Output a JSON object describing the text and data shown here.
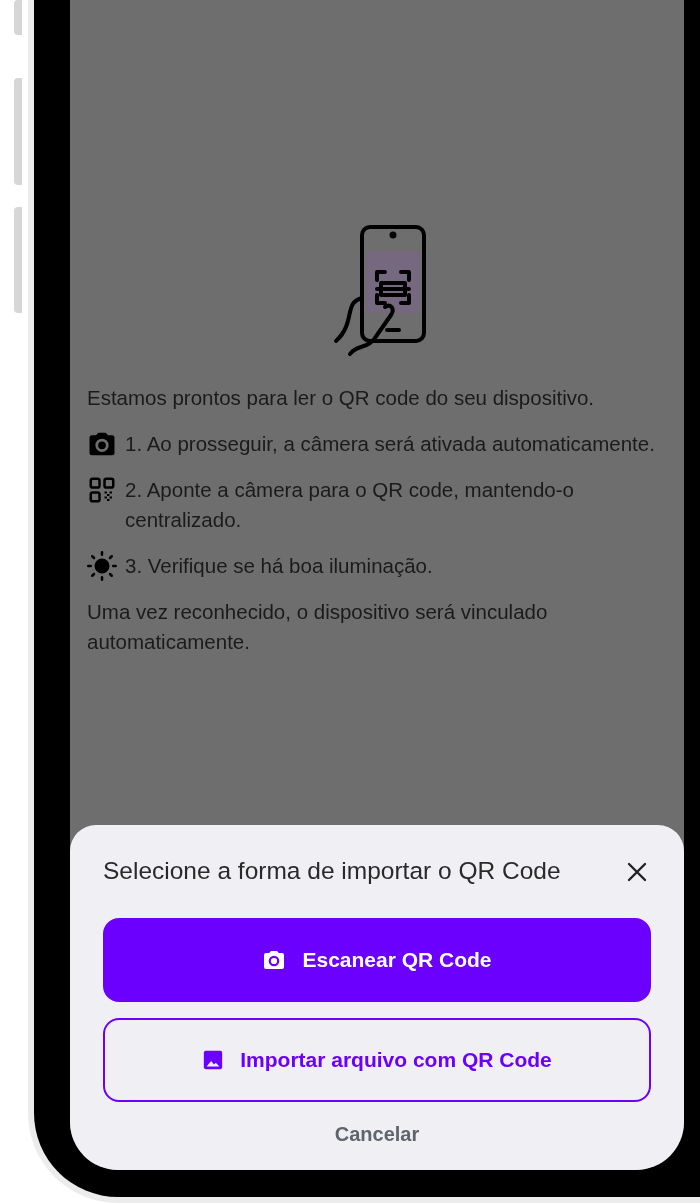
{
  "screen": {
    "intro": "Estamos prontos para ler o QR code do seu dispositivo.",
    "steps": [
      {
        "kind": "camera",
        "text": "1. Ao prosseguir, a câmera será ativada automaticamente."
      },
      {
        "kind": "qr",
        "text": "2. Aponte a câmera para o QR code, mantendo-o centralizado."
      },
      {
        "kind": "sun",
        "text": "3. Verifique se há boa iluminação."
      }
    ],
    "outro": "Uma vez reconhecido, o dispositivo será vinculado automaticamente."
  },
  "bottom_sheet": {
    "title": "Selecione a forma de importar o QR Code",
    "buttons": [
      {
        "kind": "primary",
        "label": "Escanear QR Code"
      },
      {
        "kind": "outline",
        "label": "Importar arquivo com QR Code"
      }
    ],
    "cancel": "Cancelar"
  }
}
